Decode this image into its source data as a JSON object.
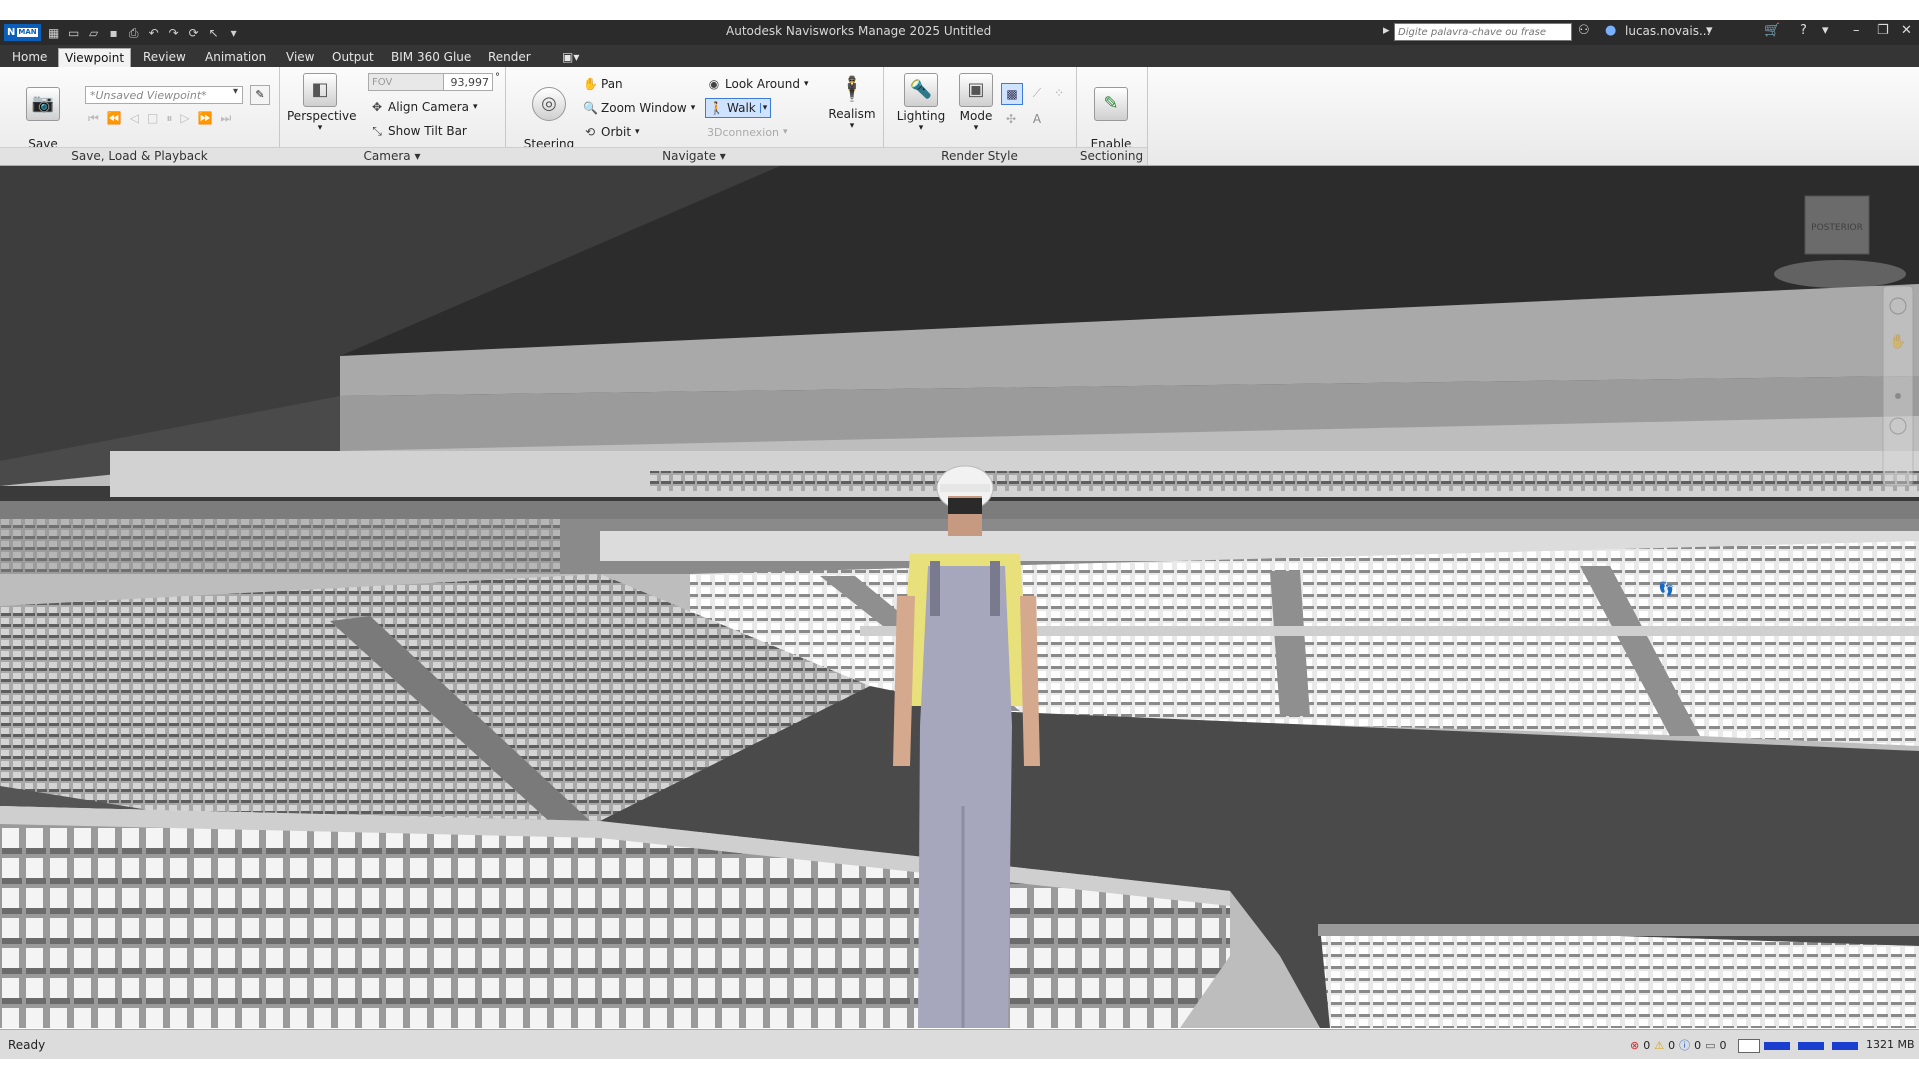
{
  "window": {
    "title": "Autodesk Navisworks Manage 2025    Untitled",
    "app_button": "N",
    "app_tag": "MAN",
    "search_placeholder": "Digite palavra-chave ou frase",
    "user": "lucas.novais..."
  },
  "tabs": [
    {
      "label": "Home"
    },
    {
      "label": "Viewpoint",
      "active": true
    },
    {
      "label": "Review"
    },
    {
      "label": "Animation"
    },
    {
      "label": "View"
    },
    {
      "label": "Output"
    },
    {
      "label": "BIM 360 Glue"
    },
    {
      "label": "Render"
    }
  ],
  "ribbon": {
    "save_load": {
      "title": "Save, Load & Playback",
      "save_viewpoint": "Save\nViewpoint",
      "viewpoint_combo": "*Unsaved Viewpoint*"
    },
    "camera": {
      "title": "Camera",
      "perspective": "Perspective",
      "fov_label": "FOV",
      "fov_value": "93,997",
      "degree": "°",
      "align_camera": "Align Camera",
      "show_tilt_bar": "Show Tilt Bar"
    },
    "navigate": {
      "title": "Navigate",
      "steering_wheels": "Steering\nWheels",
      "pan": "Pan",
      "zoom_window": "Zoom Window",
      "orbit": "Orbit",
      "look_around": "Look Around",
      "walk": "Walk",
      "connexion": "3Dconnexion",
      "realism": "Realism"
    },
    "render_style": {
      "title": "Render Style",
      "lighting": "Lighting",
      "mode": "Mode"
    },
    "sectioning": {
      "title": "Sectioning",
      "enable_sectioning": "Enable\nSectioning"
    }
  },
  "viewcube": {
    "label": "POSTERIOR"
  },
  "status": {
    "text": "Ready",
    "errors": "0",
    "warnings": "0",
    "info": "0",
    "notes": "0",
    "memory": "1321 MB"
  }
}
